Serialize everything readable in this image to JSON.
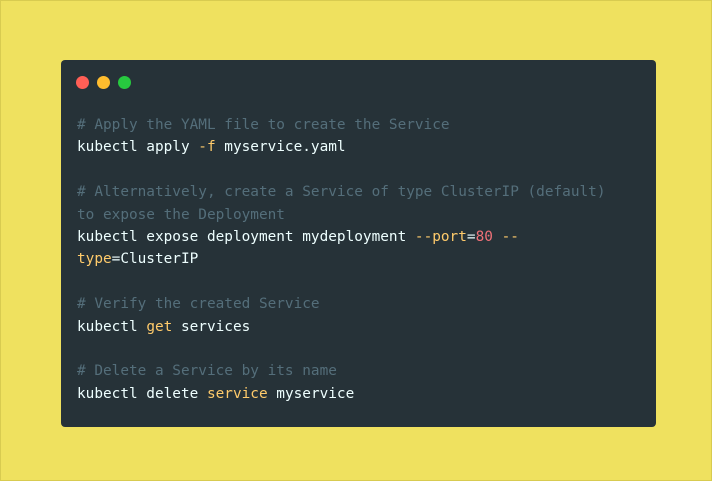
{
  "colors": {
    "background": "#efe15f",
    "window": "#263238",
    "dot_close": "#ff5f56",
    "dot_minimize": "#ffbd2e",
    "dot_maximize": "#27c93f",
    "comment": "#546e7a",
    "text": "#eeffff",
    "keyword": "#ffcb6b",
    "flag": "#f78c6c",
    "number": "#f07178"
  },
  "window_controls": [
    "close-dot",
    "minimize-dot",
    "maximize-dot"
  ],
  "code": {
    "lines": [
      {
        "kind": "comment",
        "segments": [
          {
            "t": "# Apply the YAML file to create the Service",
            "c": "comment"
          }
        ]
      },
      {
        "kind": "code",
        "segments": [
          {
            "t": "kubectl apply ",
            "c": "plain"
          },
          {
            "t": "-f",
            "c": "kw"
          },
          {
            "t": " myservice.yaml",
            "c": "plain"
          }
        ]
      },
      {
        "kind": "blank",
        "segments": []
      },
      {
        "kind": "comment",
        "segments": [
          {
            "t": "# Alternatively, create a Service of type ClusterIP (default)",
            "c": "comment"
          }
        ]
      },
      {
        "kind": "comment",
        "segments": [
          {
            "t": "to expose the Deployment",
            "c": "comment"
          }
        ]
      },
      {
        "kind": "code",
        "segments": [
          {
            "t": "kubectl expose deployment mydeployment ",
            "c": "plain"
          },
          {
            "t": "--port",
            "c": "kw"
          },
          {
            "t": "=",
            "c": "plain"
          },
          {
            "t": "80",
            "c": "num"
          },
          {
            "t": " ",
            "c": "plain"
          },
          {
            "t": "--",
            "c": "kw"
          }
        ]
      },
      {
        "kind": "code",
        "segments": [
          {
            "t": "type",
            "c": "kw"
          },
          {
            "t": "=ClusterIP",
            "c": "plain"
          }
        ]
      },
      {
        "kind": "blank",
        "segments": []
      },
      {
        "kind": "comment",
        "segments": [
          {
            "t": "# Verify the created Service",
            "c": "comment"
          }
        ]
      },
      {
        "kind": "code",
        "segments": [
          {
            "t": "kubectl ",
            "c": "plain"
          },
          {
            "t": "get",
            "c": "kw"
          },
          {
            "t": " services",
            "c": "plain"
          }
        ]
      },
      {
        "kind": "blank",
        "segments": []
      },
      {
        "kind": "comment",
        "segments": [
          {
            "t": "# Delete a Service by its name",
            "c": "comment"
          }
        ]
      },
      {
        "kind": "code",
        "segments": [
          {
            "t": "kubectl delete ",
            "c": "plain"
          },
          {
            "t": "service",
            "c": "kw"
          },
          {
            "t": " myservice",
            "c": "plain"
          }
        ]
      }
    ]
  }
}
